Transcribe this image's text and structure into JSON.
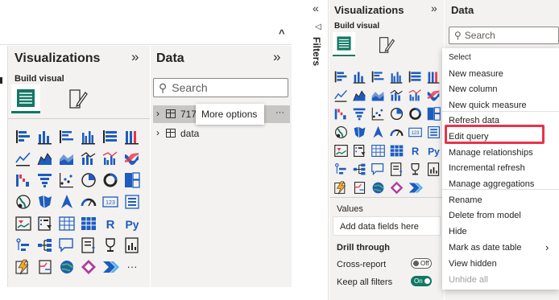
{
  "left": {
    "viz_title": "Visualizations",
    "build_visual": "Build visual",
    "data_title": "Data",
    "search_placeholder": "Search",
    "table1": "717",
    "table2": "data",
    "tooltip": "More options",
    "ellipsis": "···",
    "more_visuals": "···"
  },
  "right": {
    "viz_title": "Visualizations",
    "build_visual": "Build visual",
    "data_title": "Data",
    "search_placeholder": "Search",
    "filters": "Filters",
    "values_label": "Values",
    "add_fields": "Add data fields here",
    "drill_through": "Drill through",
    "cross_report": "Cross-report",
    "cross_report_toggle": "Off",
    "keep_filters": "Keep all filters",
    "keep_filters_toggle": "On",
    "menu": {
      "select": "Select",
      "items": [
        "New measure",
        "New column",
        "New quick measure",
        "Refresh data",
        "Edit query",
        "Manage relationships",
        "Incremental refresh",
        "Manage aggregations",
        "Rename",
        "Delete from model",
        "Hide",
        "Mark as date table",
        "View hidden",
        "Unhide all"
      ]
    }
  },
  "colors": {
    "accent": "#117865",
    "highlight": "#e8334a",
    "pane": "#f3f2f1",
    "icon_blue": "#1e5cbd",
    "icon_red": "#e8334a"
  }
}
